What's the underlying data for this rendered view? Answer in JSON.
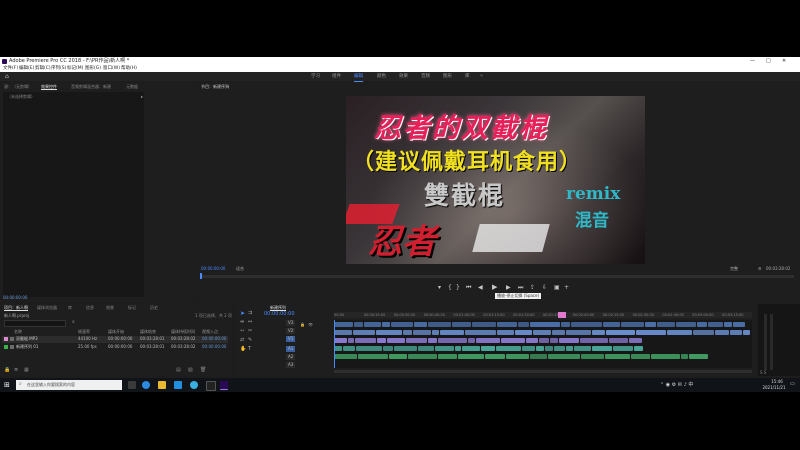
{
  "window": {
    "title": "Adobe Premiere Pro CC 2018 - F:\\PR作品\\新人啊 *",
    "controls": [
      "—",
      "□",
      "✕"
    ]
  },
  "menu": [
    "文件(F)",
    "编辑(E)",
    "剪辑(C)",
    "序列(S)",
    "标记(M)",
    "图形(G)",
    "窗口(W)",
    "帮助(H)"
  ],
  "workspaces": [
    "学习",
    "组件",
    "编辑",
    "颜色",
    "效果",
    "音频",
    "图形",
    "库"
  ],
  "active_workspace": "编辑",
  "source_panel": {
    "tabs": [
      "源：（无剪辑）",
      "效果控件",
      "音频剪辑混合器：新建",
      "元数据"
    ],
    "active_tab": "效果控件",
    "placeholder": "（未选择剪辑）",
    "timecode": "00:00:00:00"
  },
  "program_monitor": {
    "tab": "节目：新建序列",
    "timecode_left": "00:00:00:00",
    "zoom": "适合",
    "quality": "完整",
    "timecode_right": "00:03:28:02",
    "tooltip": "播放-停止切换 (Space)",
    "video": {
      "title_line1": "忍者的双截棍",
      "title_line2": "（建议佩戴耳机食用）",
      "subtitle": "雙截棍",
      "remix": "remix",
      "mix": "混音",
      "logo": "忍者",
      "colors": {
        "title1": "#e8205a",
        "title2": "#f0e020",
        "remix": "#2fb8c8",
        "mix": "#2fb8c8"
      }
    }
  },
  "project_panel": {
    "tabs": [
      "项目：新人啊",
      "媒体浏览器",
      "库",
      "信息",
      "效果",
      "标记",
      "历史"
    ],
    "active_tab": "项目：新人啊",
    "file": "新人啊.prproj",
    "item_count": "1 项已选择，共 2 项",
    "columns": [
      "名称",
      "帧速率",
      "媒体开始",
      "媒体结束",
      "媒体持续时间",
      "视频入点"
    ],
    "rows": [
      {
        "name": "双截棍.MP3",
        "fps": "44100 Hz",
        "start": "00:00:00:00",
        "end": "00:03:28:01",
        "dur": "00:03:28:02",
        "in": "00:00:00:00",
        "color": "#e08bd0"
      },
      {
        "name": "新建序列 01",
        "fps": "25.00 fps",
        "start": "00:00:00:00",
        "end": "00:03:28:01",
        "dur": "00:03:28:02",
        "in": "00:00:00:00",
        "color": "#36b34a"
      }
    ]
  },
  "timeline": {
    "tab": "新建序列",
    "timecode": "00:00:00:00",
    "tracks": [
      "V3",
      "V2",
      "V1",
      "A1",
      "A2",
      "A3"
    ],
    "ruler": [
      "00:00",
      "00:00:15:00",
      "00:00:30:00",
      "00:00:45:00",
      "00:01:00:00",
      "00:01:15:00",
      "00:01:30:00",
      "00:01:45:00",
      "00:02:00:00",
      "00:02:15:00",
      "00:02:30:00",
      "00:02:45:00",
      "00:03:00:00",
      "00:03:15:00"
    ]
  },
  "taskbar": {
    "search_placeholder": "在这里输入你要搜索的内容",
    "time": "15:46",
    "date": "2021/11/21"
  }
}
